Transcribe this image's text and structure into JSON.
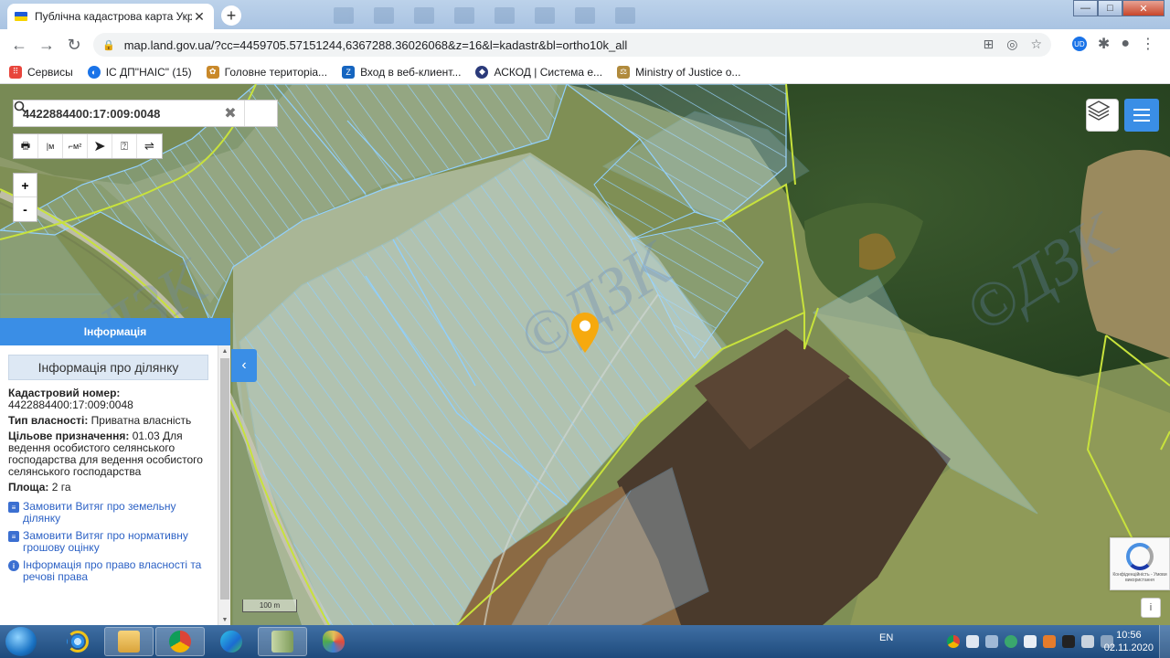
{
  "browser": {
    "tab_title": "Публічна кадастрова карта Укр",
    "tab_close": "✕",
    "new_tab": "+",
    "url": "map.land.gov.ua/?cc=4459705.57151244,6367288.36026068&z=16&l=kadastr&bl=ortho10k_all",
    "bookmarks": [
      {
        "label": "Сервисы",
        "icon": "apps-grid-icon",
        "color": "#e8453c"
      },
      {
        "label": "ІС ДП\"НАІС\" (15)",
        "icon": "nais-icon",
        "color": "#1a73e8"
      },
      {
        "label": "Головне територіа...",
        "icon": "emblem-icon",
        "color": "#c9892a"
      },
      {
        "label": "Вход в веб-клиент...",
        "icon": "zimbra-icon",
        "color": "#1565c0"
      },
      {
        "label": "АСКОД | Система е...",
        "icon": "askod-icon",
        "color": "#2b3a7a"
      },
      {
        "label": "Ministry of Justice o...",
        "icon": "scales-icon",
        "color": "#b08a3c"
      }
    ]
  },
  "map": {
    "search_value": "4422884400:17:009:0048",
    "zoom_in": "+",
    "zoom_out": "-",
    "scale_label": "100 m",
    "tools": [
      "print",
      "measure-length",
      "measure-area",
      "select",
      "identify",
      "route"
    ],
    "recaptcha_text": "Конфіденційність - Умови використання",
    "info_btn": "i",
    "watermark": "©ДЗК"
  },
  "panel": {
    "header": "Інформація",
    "subheader": "Інформація про ділянку",
    "cadastral_label": "Кадастровий номер:",
    "cadastral_value": "4422884400:17:009:0048",
    "ownership_label": "Тип власності:",
    "ownership_value": "Приватна власність",
    "purpose_label": "Цільове призначення:",
    "purpose_value": "01.03 Для ведення особистого селянського господарства для ведення особистого селянського господарства",
    "area_label": "Площа:",
    "area_value": "2 га",
    "links": [
      {
        "label": "Замовити Витяг про земельну ділянку",
        "icon": "document-icon"
      },
      {
        "label": "Замовити Витяг про нормативну грошову оцінку",
        "icon": "document-icon"
      },
      {
        "label": "Інформація про право власності та речові права",
        "icon": "info-circle-icon"
      }
    ],
    "collapse": "‹"
  },
  "taskbar": {
    "lang": "EN",
    "time": "10:56",
    "date": "02.11.2020",
    "apps": [
      "internet-explorer",
      "file-explorer",
      "chrome",
      "edge",
      "archive",
      "paint"
    ]
  }
}
